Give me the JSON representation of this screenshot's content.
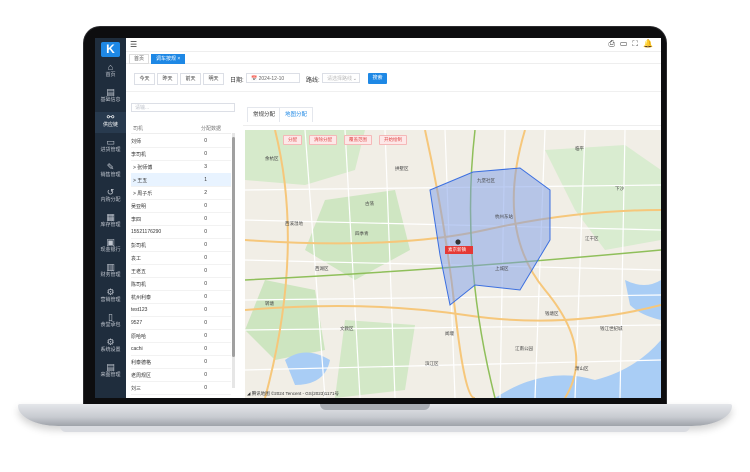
{
  "app": {
    "logo_letter": "K",
    "sidebar": [
      {
        "icon": "home-icon",
        "glyph": "⌂",
        "label": "首页"
      },
      {
        "icon": "database-icon",
        "glyph": "▤",
        "label": "基础信息"
      },
      {
        "icon": "link-icon",
        "glyph": "⚯",
        "label": "供应链"
      },
      {
        "icon": "truck-icon",
        "glyph": "▭",
        "label": "进货管理"
      },
      {
        "icon": "tag-icon",
        "glyph": "✎",
        "label": "销售管理"
      },
      {
        "icon": "return-icon",
        "glyph": "↺",
        "label": "内购分配"
      },
      {
        "icon": "warehouse-icon",
        "glyph": "▦",
        "label": "库存管理"
      },
      {
        "icon": "bank-icon",
        "glyph": "▣",
        "label": "现金银行"
      },
      {
        "icon": "finance-icon",
        "glyph": "▥",
        "label": "财务管理"
      },
      {
        "icon": "gear-icon",
        "glyph": "⚙",
        "label": "营销管理"
      },
      {
        "icon": "mobile-icon",
        "glyph": "▯",
        "label": "食堂承包"
      },
      {
        "icon": "settings-icon",
        "glyph": "⚙",
        "label": "系统设置"
      },
      {
        "icon": "delivery-icon",
        "glyph": "▤",
        "label": "来图管理"
      }
    ],
    "active_nav_index": 2
  },
  "header": {
    "menu_icon": "☰",
    "right_icons": [
      "printer-icon",
      "book-icon",
      "expand-icon",
      "bell-icon"
    ],
    "right_glyphs": [
      "⎙",
      "▭",
      "⛶",
      "🔔"
    ]
  },
  "tabs": [
    {
      "label": "首页",
      "active": false
    },
    {
      "label": "调车按规 ×",
      "active": true
    }
  ],
  "filter": {
    "quick_buttons": [
      "今天",
      "昨天",
      "前天",
      "明天"
    ],
    "date_label": "日期:",
    "date_value": "📅 2024-12-10",
    "route_label": "路线:",
    "route_placeholder": "请选择路线",
    "route_arrow": "⌄",
    "search_label": "搜索"
  },
  "drivers": {
    "search_placeholder": "请输...",
    "col_driver": "司机",
    "col_count": "分配数据",
    "rows": [
      {
        "name": "刘师",
        "count": "0"
      },
      {
        "name": "李司机",
        "count": "0"
      },
      {
        "name": "> 张师傅",
        "count": "3"
      },
      {
        "name": "> 王五",
        "count": "1"
      },
      {
        "name": "> 周子乐",
        "count": "2"
      },
      {
        "name": "吴亚明",
        "count": "0"
      },
      {
        "name": "李四",
        "count": "0"
      },
      {
        "name": "15521176290",
        "count": "0"
      },
      {
        "name": "彭司机",
        "count": "0"
      },
      {
        "name": "袁工",
        "count": "0"
      },
      {
        "name": "王老五",
        "count": "0"
      },
      {
        "name": "陈司机",
        "count": "0"
      },
      {
        "name": "杭州利泰",
        "count": "0"
      },
      {
        "name": "test123",
        "count": "0"
      },
      {
        "name": "9527",
        "count": "0"
      },
      {
        "name": "原哈哈",
        "count": "0"
      },
      {
        "name": "cachi",
        "count": "0"
      },
      {
        "name": "利泰德格",
        "count": "0"
      },
      {
        "name": "老周规区",
        "count": "0"
      },
      {
        "name": "刘三",
        "count": "0"
      }
    ],
    "highlight_index": 3
  },
  "map": {
    "tabs": [
      {
        "label": "常规分配",
        "active": false
      },
      {
        "label": "地图分配",
        "active": true
      }
    ],
    "tools": [
      "分配",
      "清除分配",
      "覆盖范围",
      "开始绘制"
    ],
    "marker_label": "素京新镇",
    "copyright": "◢ 腾讯地图  ©2024 Tencent - GS(2023)1171号",
    "places": [
      "九堡社区",
      "杭州东站",
      "钱塘区",
      "西溪湿地",
      "萧山区",
      "滨江区",
      "西湖区",
      "余杭区",
      "上城区",
      "拱墅区",
      "江干区",
      "下沙",
      "临平",
      "四季青",
      "古荡",
      "转塘",
      "闻堰",
      "江南公园",
      "文教区",
      "钱江世纪城"
    ],
    "colors": {
      "polygon_fill": "#7b9be8",
      "polygon_stroke": "#3b6fe0",
      "water": "#a9cdf5",
      "park": "#cfe6c2",
      "road_major": "#f6c77b",
      "road_minor": "#ffffff"
    }
  }
}
